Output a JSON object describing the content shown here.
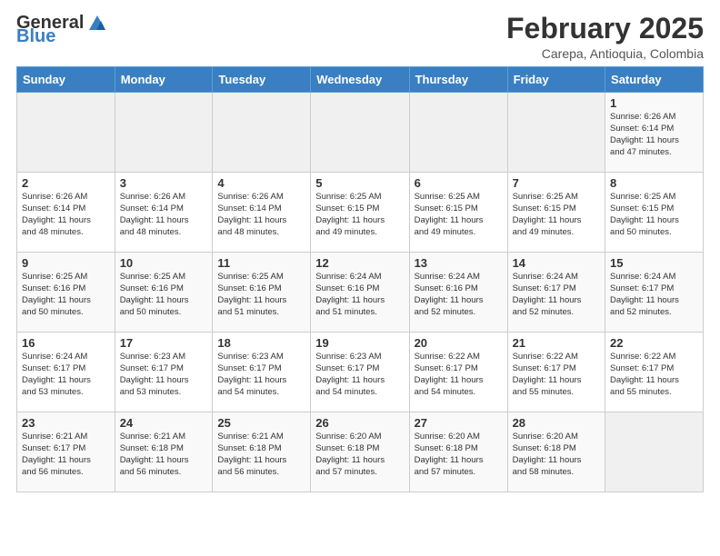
{
  "header": {
    "logo_general": "General",
    "logo_blue": "Blue",
    "title": "February 2025",
    "subtitle": "Carepa, Antioquia, Colombia"
  },
  "weekdays": [
    "Sunday",
    "Monday",
    "Tuesday",
    "Wednesday",
    "Thursday",
    "Friday",
    "Saturday"
  ],
  "weeks": [
    [
      {
        "day": "",
        "info": ""
      },
      {
        "day": "",
        "info": ""
      },
      {
        "day": "",
        "info": ""
      },
      {
        "day": "",
        "info": ""
      },
      {
        "day": "",
        "info": ""
      },
      {
        "day": "",
        "info": ""
      },
      {
        "day": "1",
        "info": "Sunrise: 6:26 AM\nSunset: 6:14 PM\nDaylight: 11 hours\nand 47 minutes."
      }
    ],
    [
      {
        "day": "2",
        "info": "Sunrise: 6:26 AM\nSunset: 6:14 PM\nDaylight: 11 hours\nand 48 minutes."
      },
      {
        "day": "3",
        "info": "Sunrise: 6:26 AM\nSunset: 6:14 PM\nDaylight: 11 hours\nand 48 minutes."
      },
      {
        "day": "4",
        "info": "Sunrise: 6:26 AM\nSunset: 6:14 PM\nDaylight: 11 hours\nand 48 minutes."
      },
      {
        "day": "5",
        "info": "Sunrise: 6:25 AM\nSunset: 6:15 PM\nDaylight: 11 hours\nand 49 minutes."
      },
      {
        "day": "6",
        "info": "Sunrise: 6:25 AM\nSunset: 6:15 PM\nDaylight: 11 hours\nand 49 minutes."
      },
      {
        "day": "7",
        "info": "Sunrise: 6:25 AM\nSunset: 6:15 PM\nDaylight: 11 hours\nand 49 minutes."
      },
      {
        "day": "8",
        "info": "Sunrise: 6:25 AM\nSunset: 6:15 PM\nDaylight: 11 hours\nand 50 minutes."
      }
    ],
    [
      {
        "day": "9",
        "info": "Sunrise: 6:25 AM\nSunset: 6:16 PM\nDaylight: 11 hours\nand 50 minutes."
      },
      {
        "day": "10",
        "info": "Sunrise: 6:25 AM\nSunset: 6:16 PM\nDaylight: 11 hours\nand 50 minutes."
      },
      {
        "day": "11",
        "info": "Sunrise: 6:25 AM\nSunset: 6:16 PM\nDaylight: 11 hours\nand 51 minutes."
      },
      {
        "day": "12",
        "info": "Sunrise: 6:24 AM\nSunset: 6:16 PM\nDaylight: 11 hours\nand 51 minutes."
      },
      {
        "day": "13",
        "info": "Sunrise: 6:24 AM\nSunset: 6:16 PM\nDaylight: 11 hours\nand 52 minutes."
      },
      {
        "day": "14",
        "info": "Sunrise: 6:24 AM\nSunset: 6:17 PM\nDaylight: 11 hours\nand 52 minutes."
      },
      {
        "day": "15",
        "info": "Sunrise: 6:24 AM\nSunset: 6:17 PM\nDaylight: 11 hours\nand 52 minutes."
      }
    ],
    [
      {
        "day": "16",
        "info": "Sunrise: 6:24 AM\nSunset: 6:17 PM\nDaylight: 11 hours\nand 53 minutes."
      },
      {
        "day": "17",
        "info": "Sunrise: 6:23 AM\nSunset: 6:17 PM\nDaylight: 11 hours\nand 53 minutes."
      },
      {
        "day": "18",
        "info": "Sunrise: 6:23 AM\nSunset: 6:17 PM\nDaylight: 11 hours\nand 54 minutes."
      },
      {
        "day": "19",
        "info": "Sunrise: 6:23 AM\nSunset: 6:17 PM\nDaylight: 11 hours\nand 54 minutes."
      },
      {
        "day": "20",
        "info": "Sunrise: 6:22 AM\nSunset: 6:17 PM\nDaylight: 11 hours\nand 54 minutes."
      },
      {
        "day": "21",
        "info": "Sunrise: 6:22 AM\nSunset: 6:17 PM\nDaylight: 11 hours\nand 55 minutes."
      },
      {
        "day": "22",
        "info": "Sunrise: 6:22 AM\nSunset: 6:17 PM\nDaylight: 11 hours\nand 55 minutes."
      }
    ],
    [
      {
        "day": "23",
        "info": "Sunrise: 6:21 AM\nSunset: 6:17 PM\nDaylight: 11 hours\nand 56 minutes."
      },
      {
        "day": "24",
        "info": "Sunrise: 6:21 AM\nSunset: 6:18 PM\nDaylight: 11 hours\nand 56 minutes."
      },
      {
        "day": "25",
        "info": "Sunrise: 6:21 AM\nSunset: 6:18 PM\nDaylight: 11 hours\nand 56 minutes."
      },
      {
        "day": "26",
        "info": "Sunrise: 6:20 AM\nSunset: 6:18 PM\nDaylight: 11 hours\nand 57 minutes."
      },
      {
        "day": "27",
        "info": "Sunrise: 6:20 AM\nSunset: 6:18 PM\nDaylight: 11 hours\nand 57 minutes."
      },
      {
        "day": "28",
        "info": "Sunrise: 6:20 AM\nSunset: 6:18 PM\nDaylight: 11 hours\nand 58 minutes."
      },
      {
        "day": "",
        "info": ""
      }
    ]
  ]
}
